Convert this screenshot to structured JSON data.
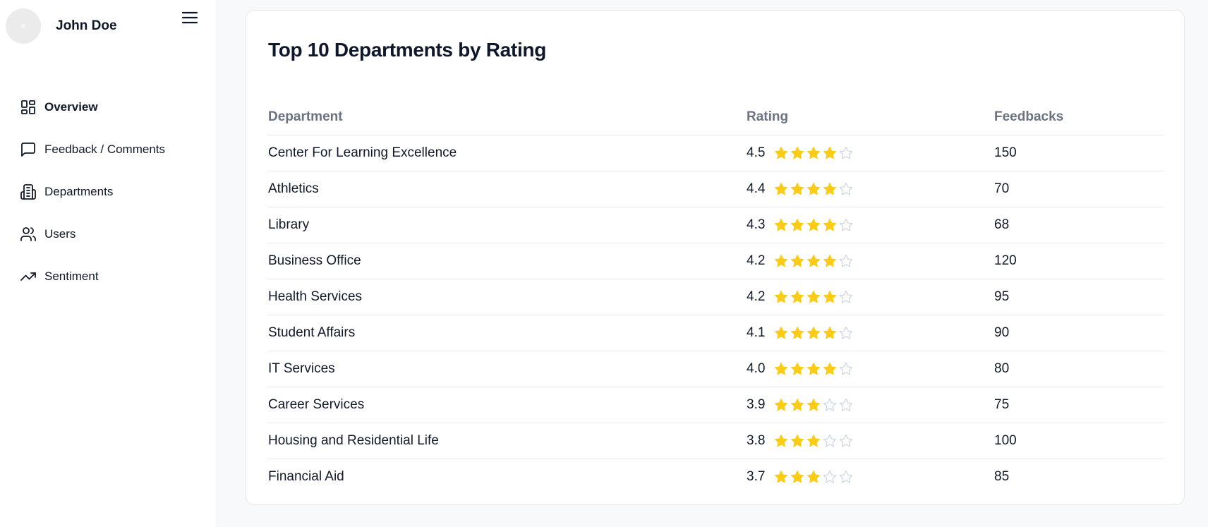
{
  "user": {
    "name": "John Doe"
  },
  "sidebar": {
    "items": [
      {
        "label": "Overview",
        "icon": "dashboard-icon",
        "active": true
      },
      {
        "label": "Feedback / Comments",
        "icon": "message-square-icon",
        "active": false
      },
      {
        "label": "Departments",
        "icon": "building-icon",
        "active": false
      },
      {
        "label": "Users",
        "icon": "users-icon",
        "active": false
      },
      {
        "label": "Sentiment",
        "icon": "trending-up-icon",
        "active": false
      }
    ]
  },
  "main": {
    "card": {
      "title": "Top 10 Departments by Rating",
      "columns": [
        "Department",
        "Rating",
        "Feedbacks"
      ],
      "rows": [
        {
          "department": "Center For Learning Excellence",
          "rating": "4.5",
          "stars_filled": 4,
          "feedbacks": "150"
        },
        {
          "department": "Athletics",
          "rating": "4.4",
          "stars_filled": 4,
          "feedbacks": "70"
        },
        {
          "department": "Library",
          "rating": "4.3",
          "stars_filled": 4,
          "feedbacks": "68"
        },
        {
          "department": "Business Office",
          "rating": "4.2",
          "stars_filled": 4,
          "feedbacks": "120"
        },
        {
          "department": "Health Services",
          "rating": "4.2",
          "stars_filled": 4,
          "feedbacks": "95"
        },
        {
          "department": "Student Affairs",
          "rating": "4.1",
          "stars_filled": 4,
          "feedbacks": "90"
        },
        {
          "department": "IT Services",
          "rating": "4.0",
          "stars_filled": 4,
          "feedbacks": "80"
        },
        {
          "department": "Career Services",
          "rating": "3.9",
          "stars_filled": 3,
          "feedbacks": "75"
        },
        {
          "department": "Housing and Residential Life",
          "rating": "3.8",
          "stars_filled": 3,
          "feedbacks": "100"
        },
        {
          "department": "Financial Aid",
          "rating": "3.7",
          "stars_filled": 3,
          "feedbacks": "85"
        }
      ],
      "stars_total": 5
    }
  },
  "colors": {
    "star_filled": "#facc15",
    "star_empty": "#cbd5e1",
    "header_text": "#6b7280",
    "page_bg": "#f8f9fb"
  }
}
